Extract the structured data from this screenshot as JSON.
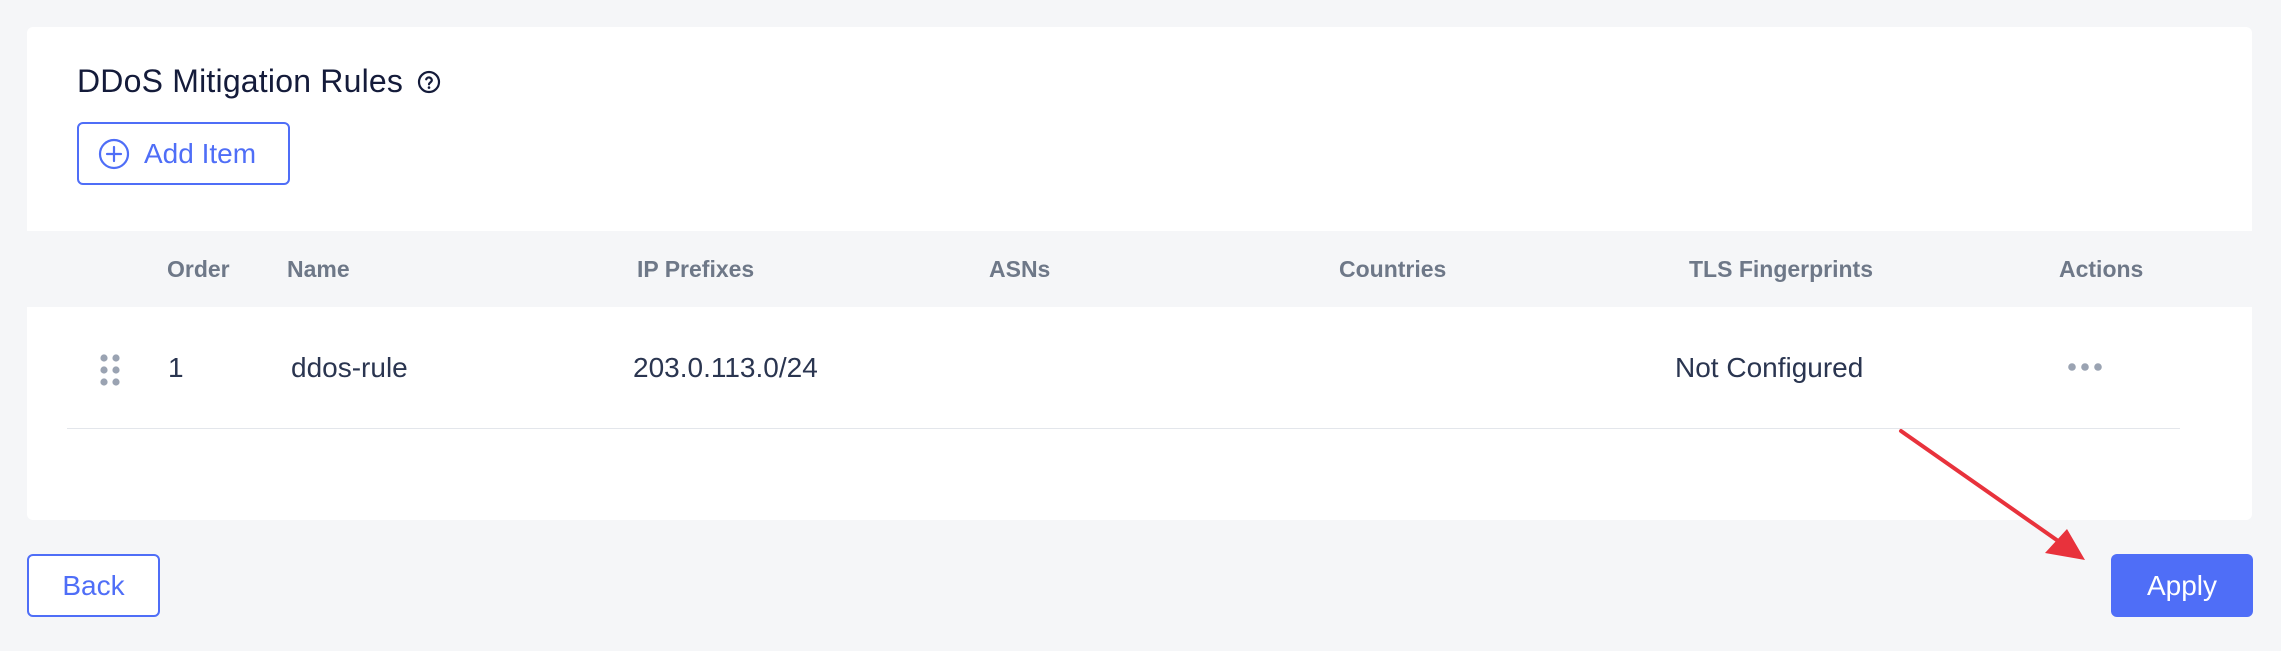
{
  "section": {
    "title": "DDoS Mitigation Rules",
    "help_icon": "help-circle-icon",
    "add_button_label": "Add Item",
    "add_icon": "plus-circle-icon"
  },
  "table": {
    "columns": {
      "order": "Order",
      "name": "Name",
      "ip_prefixes": "IP Prefixes",
      "asns": "ASNs",
      "countries": "Countries",
      "tls_fingerprints": "TLS Fingerprints",
      "actions": "Actions"
    },
    "rows": [
      {
        "order": "1",
        "name": "ddos-rule",
        "ip_prefixes": "203.0.113.0/24",
        "asns": "",
        "countries": "",
        "tls_fingerprints": "Not Configured",
        "drag_icon": "drag-handle-icon",
        "actions_icon": "more-horizontal-icon"
      }
    ]
  },
  "footer": {
    "back_label": "Back",
    "apply_label": "Apply"
  },
  "annotation": {
    "arrow_color": "#e8323c"
  },
  "colors": {
    "accent": "#4f6ef7",
    "background": "#f5f6f8",
    "card": "#ffffff"
  }
}
